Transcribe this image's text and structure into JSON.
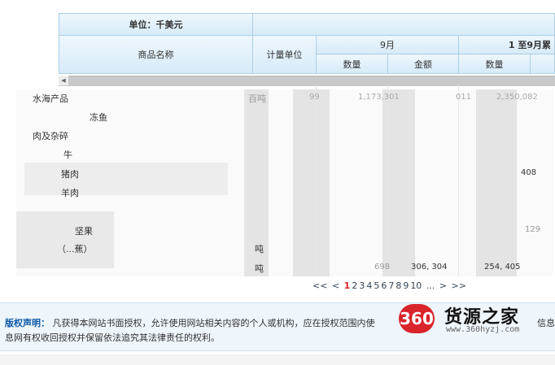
{
  "table": {
    "unit_label": "单位：千美元",
    "col_product": "商品名称",
    "col_unit": "计量单位",
    "col_sept": "9月",
    "col_jan_sept": "1 至9月累",
    "sub_qty": "数量",
    "sub_amount": "金额",
    "sub_qty2": "数量"
  },
  "rows": [
    {
      "name": "水海产品",
      "unit": "百吨",
      "n1": "99",
      "n2": "1,173,301",
      "n3": "011",
      "n4": "2,350,082"
    },
    {
      "name": "冻鱼"
    },
    {
      "name": "肉及杂碎"
    },
    {
      "name": "牛"
    },
    {
      "name": "猪肉",
      "n4": "408"
    },
    {
      "name": "羊肉"
    },
    {
      "name": ""
    },
    {
      "name": "坚果",
      "n4": "129"
    },
    {
      "name": "（...蕉）",
      "unit": "吨"
    },
    {
      "name": "",
      "unit": "吨",
      "n2": "698",
      "n3": "306, 304",
      "n4": "254, 405"
    }
  ],
  "pager": {
    "first": "<<",
    "prev": "<",
    "pages": [
      "1",
      "2",
      "3",
      "4",
      "5",
      "6",
      "7",
      "8",
      "9",
      "10"
    ],
    "current": "1",
    "ellipsis": "...",
    "next": ">",
    "last": ">>"
  },
  "copyright": {
    "title": "版权声明：",
    "text": "凡获得本网站书面授权，允许使用网站相关内容的个人或机构，应在授权范围内使",
    "text2": "息网有权收回授权并保留依法追究其法律责任的权利。",
    "tail": "信息"
  },
  "watermark": {
    "number": "360",
    "name": "货源之家",
    "url": "www.360hyzj.com"
  },
  "colors": {
    "header_blue": "#d7ebf8",
    "badge_red": "#d9242b",
    "title_blue": "#0d5aa6"
  }
}
